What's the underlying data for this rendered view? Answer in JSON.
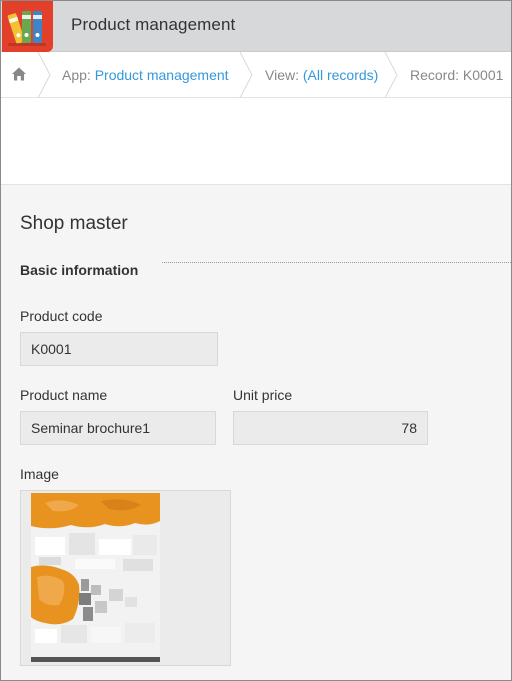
{
  "header": {
    "app_title": "Product management",
    "app_icon": "binders-app-icon"
  },
  "breadcrumb": {
    "home_icon": "home-icon",
    "app_prefix": "App: ",
    "app_link": "Product management",
    "view_prefix": "View: ",
    "view_link": "(All records)",
    "record": "Record: K0001"
  },
  "form": {
    "title": "Shop master",
    "section": "Basic information",
    "fields": {
      "product_code": {
        "label": "Product code",
        "value": "K0001"
      },
      "product_name": {
        "label": "Product name",
        "value": "Seminar brochure1"
      },
      "unit_price": {
        "label": "Unit price",
        "value": "78"
      },
      "image": {
        "label": "Image",
        "icon": "brochure-thumbnail"
      }
    }
  },
  "colors": {
    "header_bg": "#d6d8d9",
    "app_icon_bg": "#e3402b",
    "link": "#3498db",
    "field_bg": "#ebebeb",
    "content_bg": "#f5f5f5",
    "thumb_accent": "#e8931f"
  }
}
